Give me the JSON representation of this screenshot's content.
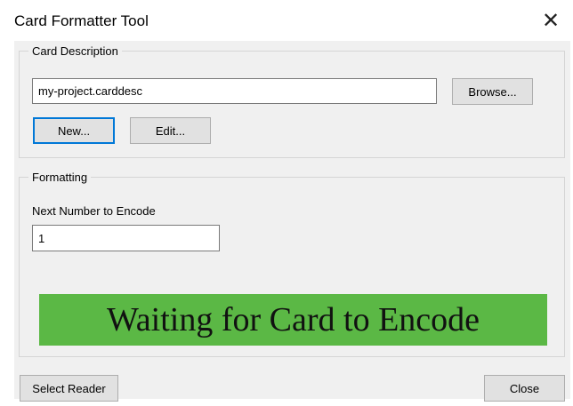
{
  "window": {
    "title": "Card Formatter Tool",
    "close_glyph": "✕"
  },
  "card_description": {
    "legend": "Card Description",
    "file_value": "my-project.carddesc",
    "browse_label": "Browse...",
    "new_label": "New...",
    "edit_label": "Edit..."
  },
  "formatting": {
    "legend": "Formatting",
    "next_number_label": "Next Number to Encode",
    "next_number_value": "1",
    "status_text": "Waiting for Card to Encode",
    "status_color": "#5bb845"
  },
  "footer": {
    "select_reader_label": "Select Reader",
    "close_label": "Close"
  }
}
